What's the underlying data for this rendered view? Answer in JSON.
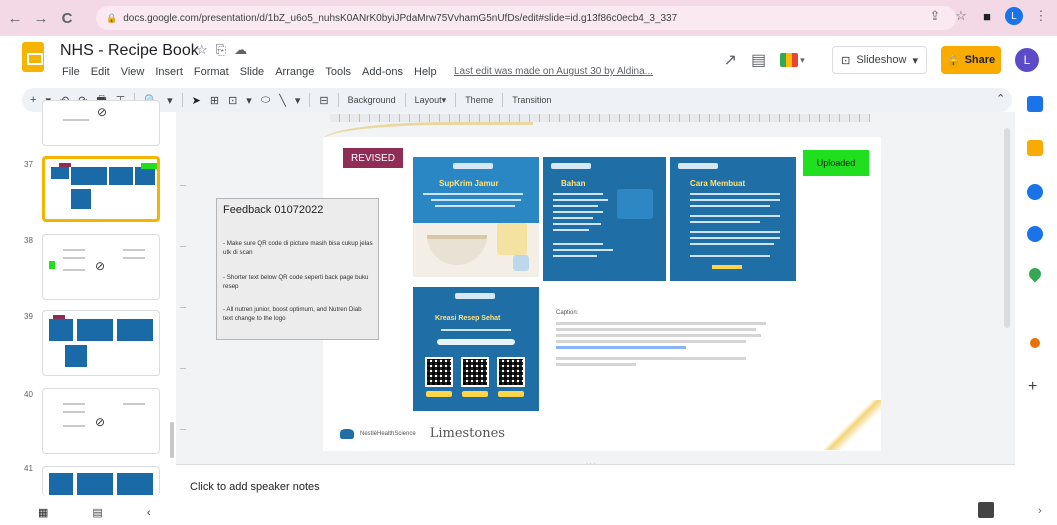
{
  "browser": {
    "back": "←",
    "forward": "→",
    "reload": "C",
    "url": "docs.google.com/presentation/d/1bZ_u6o5_nuhsK0ANrK0byiJPdaMrw75VvhamG5nUfDs/edit#slide=id.g13f86c0ecb4_3_337",
    "lock": "🔒",
    "icons": [
      "⇪",
      "☆",
      "■",
      "L"
    ],
    "menu": "⋮"
  },
  "app": {
    "title": "NHS - Recipe Book",
    "title_icons": [
      "☆",
      "⎘",
      "☁"
    ],
    "menu": [
      "File",
      "Edit",
      "View",
      "Insert",
      "Format",
      "Slide",
      "Arrange",
      "Tools",
      "Add-ons",
      "Help"
    ],
    "last_edit": "Last edit was made on August 30 by Aldina...",
    "slideshow_label": "Slideshow",
    "share_label": "Share",
    "avatar": "L"
  },
  "toolbar": {
    "icons": [
      "+",
      "▾",
      "↶",
      "↷",
      "🖶",
      "⊤",
      "🔍",
      "▾",
      "➤",
      "⊞",
      "⊡",
      "▾",
      "⬭",
      "╲",
      "▾",
      "⊟"
    ],
    "background": "Background",
    "layout": "Layout▾",
    "theme": "Theme",
    "transition": "Transition",
    "collapse": "⌃"
  },
  "filmstrip": {
    "slides": [
      {
        "num": "",
        "hidden": true
      },
      {
        "num": "37",
        "hidden": false,
        "selected": true
      },
      {
        "num": "38",
        "hidden": true
      },
      {
        "num": "39",
        "hidden": false
      },
      {
        "num": "40",
        "hidden": true
      },
      {
        "num": "41",
        "hidden": false
      }
    ],
    "grid_icon": "▦",
    "list_icon": "▤",
    "chevron": "‹"
  },
  "slide": {
    "revised": "REVISED",
    "uploaded": "Uploaded",
    "panel1_title": "SupKrim Jamur",
    "panel2_title": "Bahan",
    "panel3_title": "Cara Membuat",
    "panel4_title": "Kreasi Resep Sehat",
    "caption_title": "Caption:",
    "logo_text": "NestléHealthScience",
    "limestones": "Limestones",
    "feedback": {
      "title": "Feedback 01072022",
      "items": [
        "- Make sure QR code di picture masih bisa cukup jelas utk di scan",
        "- Shorter text below QR code seperti back page buku resep",
        "- All nutren junior, boost optimum, and Nutren Diab text change to the logo"
      ]
    }
  },
  "notes": {
    "placeholder": "Click to add speaker notes"
  },
  "colors": {
    "accent": "#f4b400",
    "revised": "#8f2d56",
    "uploaded": "#1fdf1f",
    "nestle_blue": "#1f6fa6"
  }
}
